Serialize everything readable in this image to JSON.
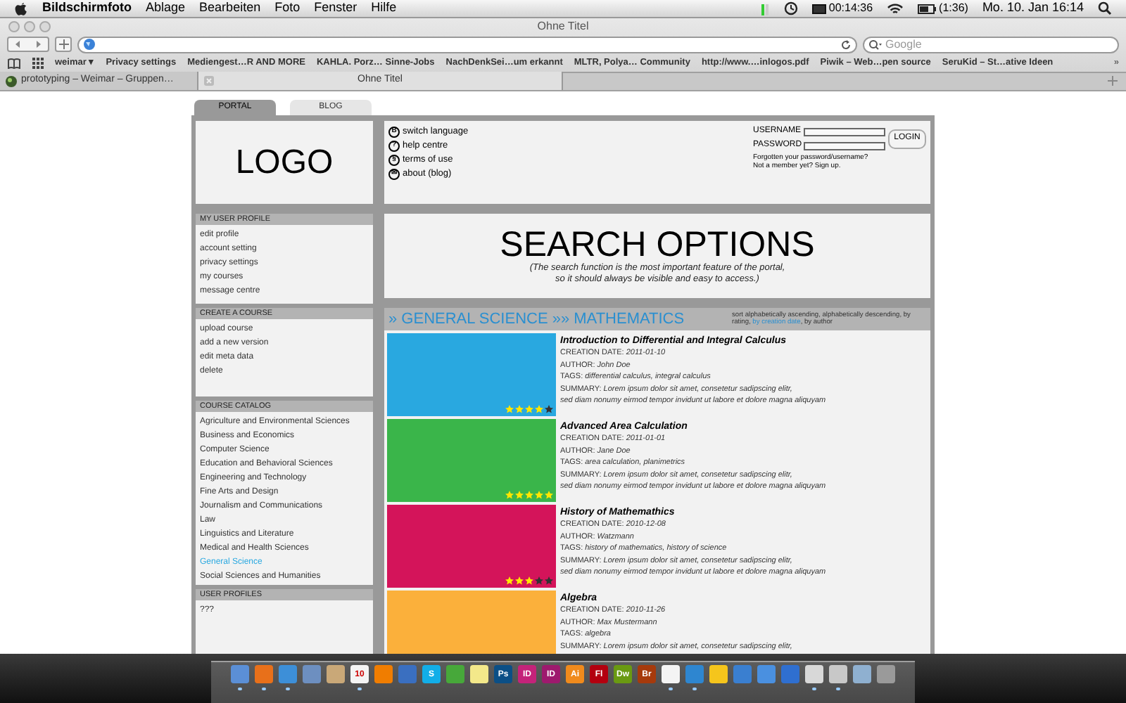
{
  "menu_bar": {
    "app": "Bildschirmfoto",
    "items": [
      "Ablage",
      "Bearbeiten",
      "Foto",
      "Fenster",
      "Hilfe"
    ],
    "timer": "00:14:36",
    "battery": "(1:36)",
    "clock": "Mo. 10. Jan 16:14"
  },
  "browser": {
    "title": "Ohne Titel",
    "search_placeholder": "Google",
    "bookmarks": [
      "weimar ▾",
      "Privacy settings",
      "Mediengest…R AND MORE",
      "KAHLA. Porz… Sinne-Jobs",
      "NachDenkSei…um erkannt",
      "MLTR, Polya… Community",
      "http://www.…inlogos.pdf",
      "Piwik – Web…pen source",
      "SeruKid – St…ative Ideen"
    ],
    "more": "»",
    "tabs": [
      {
        "label": "prototyping – Weimar – Gruppen…",
        "selected": false
      },
      {
        "label": "Ohne Titel",
        "selected": true
      }
    ]
  },
  "site_tabs": [
    {
      "label": "PORTAL",
      "selected": true
    },
    {
      "label": "BLOG",
      "selected": false
    }
  ],
  "logo": "LOGO",
  "header_links": [
    {
      "icon": "B",
      "label": "switch language"
    },
    {
      "icon": "?",
      "label": "help centre"
    },
    {
      "icon": "§",
      "label": "terms of use"
    },
    {
      "icon": "✉",
      "label": "about (blog)"
    }
  ],
  "login": {
    "username_label": "USERNAME",
    "password_label": "PASSWORD",
    "button": "LOGIN",
    "forgot": "Forgotten your password/username?",
    "signup": "Not a member yet? Sign up."
  },
  "sidebar": [
    {
      "title": "MY USER PROFILE",
      "items": [
        {
          "label": "edit profile",
          "selected": false
        },
        {
          "label": "account setting",
          "selected": false
        },
        {
          "label": "privacy settings",
          "selected": false
        },
        {
          "label": "my courses",
          "selected": false
        },
        {
          "label": "message centre",
          "selected": false
        }
      ]
    },
    {
      "title": "CREATE A COURSE",
      "items": [
        {
          "label": "upload course",
          "selected": false
        },
        {
          "label": "add a new version",
          "selected": false
        },
        {
          "label": "edit meta data",
          "selected": false
        },
        {
          "label": "delete",
          "selected": false
        }
      ]
    },
    {
      "title": "COURSE CATALOG",
      "items": [
        {
          "label": "Agriculture and Environmental Sciences",
          "selected": false
        },
        {
          "label": "Business and Economics",
          "selected": false
        },
        {
          "label": "Computer Science",
          "selected": false
        },
        {
          "label": "Education and Behavioral Sciences",
          "selected": false
        },
        {
          "label": "Engineering and Technology",
          "selected": false
        },
        {
          "label": "Fine Arts and Design",
          "selected": false
        },
        {
          "label": "Journalism and Communications",
          "selected": false
        },
        {
          "label": "Law",
          "selected": false
        },
        {
          "label": "Linguistics and Literature",
          "selected": false
        },
        {
          "label": "Medical and Health Sciences",
          "selected": false
        },
        {
          "label": "General Science",
          "selected": true
        },
        {
          "label": "Social Sciences and Humanities",
          "selected": false
        }
      ]
    },
    {
      "title": "USER PROFILES",
      "items": [
        {
          "label": "???",
          "selected": false
        }
      ]
    }
  ],
  "search_options": {
    "title": "SEARCH OPTIONS",
    "note_lines": [
      "(The search function is the most important feature of the portal,",
      "so it should always be visible and easy to access.)"
    ]
  },
  "breadcrumb": "» GENERAL SCIENCE »» MATHEMATICS",
  "sort": {
    "before": "sort alphabetically ascending, alphabetically descending, by rating, ",
    "link": "by creation date",
    "after": ", by author"
  },
  "courses": [
    {
      "color": "#29a8e0",
      "stars": 4,
      "title": "Introduction to Differential and Integral Calculus",
      "date": "2011-01-10",
      "author": "John Doe",
      "tags": "differential calculus, integral calculus",
      "labels": {
        "date": "CREATION DATE: ",
        "author": "AUTHOR: ",
        "tags": "TAGS: ",
        "summary": "SUMMARY: "
      },
      "summary_lines": [
        "Lorem ipsum dolor sit amet, consetetur sadipscing elitr,",
        "sed diam nonumy eirmod tempor invidunt ut labore et dolore magna aliquyam"
      ]
    },
    {
      "color": "#3ab54a",
      "stars": 5,
      "title": "Advanced Area Calculation",
      "date": "2011-01-01",
      "author": "Jane Doe",
      "tags": "area calculation, planimetrics",
      "labels": {
        "date": "CREATION DATE: ",
        "author": "AUTHOR: ",
        "tags": "TAGS: ",
        "summary": "SUMMARY: "
      },
      "summary_lines": [
        "Lorem ipsum dolor sit amet, consetetur sadipscing elitr,",
        "sed diam nonumy eirmod tempor invidunt ut labore et dolore magna aliquyam"
      ]
    },
    {
      "color": "#d4145a",
      "stars": 3,
      "title": "History of Mathemathics",
      "date": "2010-12-08",
      "author": "Watzmann",
      "tags": "history of mathematics, history of science",
      "labels": {
        "date": "CREATION DATE: ",
        "author": "AUTHOR: ",
        "tags": "TAGS: ",
        "summary": "SUMMARY: "
      },
      "summary_lines": [
        "Lorem ipsum dolor sit amet, consetetur sadipscing elitr,",
        "sed diam nonumy eirmod tempor invidunt ut labore et dolore magna aliquyam"
      ]
    },
    {
      "color": "#fbb03b",
      "title": "Algebra",
      "date": "2010-11-26",
      "author": "Max Mustermann",
      "tags": "algebra",
      "labels": {
        "date": "CREATION DATE: ",
        "author": "AUTHOR: ",
        "tags": "TAGS: ",
        "summary": "SUMMARY: "
      },
      "summary_lines": [
        "Lorem ipsum dolor sit amet, consetetur sadipscing elitr,"
      ]
    }
  ],
  "dock": [
    {
      "color": "#5b8fd6",
      "running": true
    },
    {
      "color": "#e8701a",
      "running": true
    },
    {
      "color": "#3d8fd8",
      "running": true
    },
    {
      "color": "#6d8fc0",
      "running": false
    },
    {
      "color": "#c9a878",
      "running": false
    },
    {
      "color": "#f4f4f4",
      "label": "10",
      "running": true
    },
    {
      "color": "#f07d00",
      "running": false
    },
    {
      "color": "#3a6fc0",
      "running": false
    },
    {
      "color": "#12aee8",
      "label": "S",
      "running": false
    },
    {
      "color": "#47a83a",
      "running": false
    },
    {
      "color": "#f3e88a",
      "running": false
    },
    {
      "color": "#0b4f86",
      "label": "Ps",
      "running": false
    },
    {
      "color": "#c4237a",
      "label": "ID",
      "running": false
    },
    {
      "color": "#9e1a6e",
      "label": "ID",
      "running": false
    },
    {
      "color": "#f08a1c",
      "label": "Ai",
      "running": false
    },
    {
      "color": "#b3000f",
      "label": "Fl",
      "running": false
    },
    {
      "color": "#6a9a12",
      "label": "Dw",
      "running": false
    },
    {
      "color": "#a63a0c",
      "label": "Br",
      "running": false
    },
    {
      "color": "#f4f4f4",
      "running": true
    },
    {
      "color": "#2e86d0",
      "running": true
    },
    {
      "color": "#f5c51c",
      "running": false
    },
    {
      "color": "#3a7fd0",
      "running": false
    },
    {
      "color": "#4a90e0",
      "running": false
    },
    {
      "color": "#2f6fd0",
      "running": false
    },
    {
      "color": "#d8d8d8",
      "running": true
    },
    {
      "color": "#c8c8c8",
      "running": true
    },
    {
      "color": "#8fb0d0",
      "running": false
    },
    {
      "color": "#9a9a9a",
      "running": false
    }
  ]
}
